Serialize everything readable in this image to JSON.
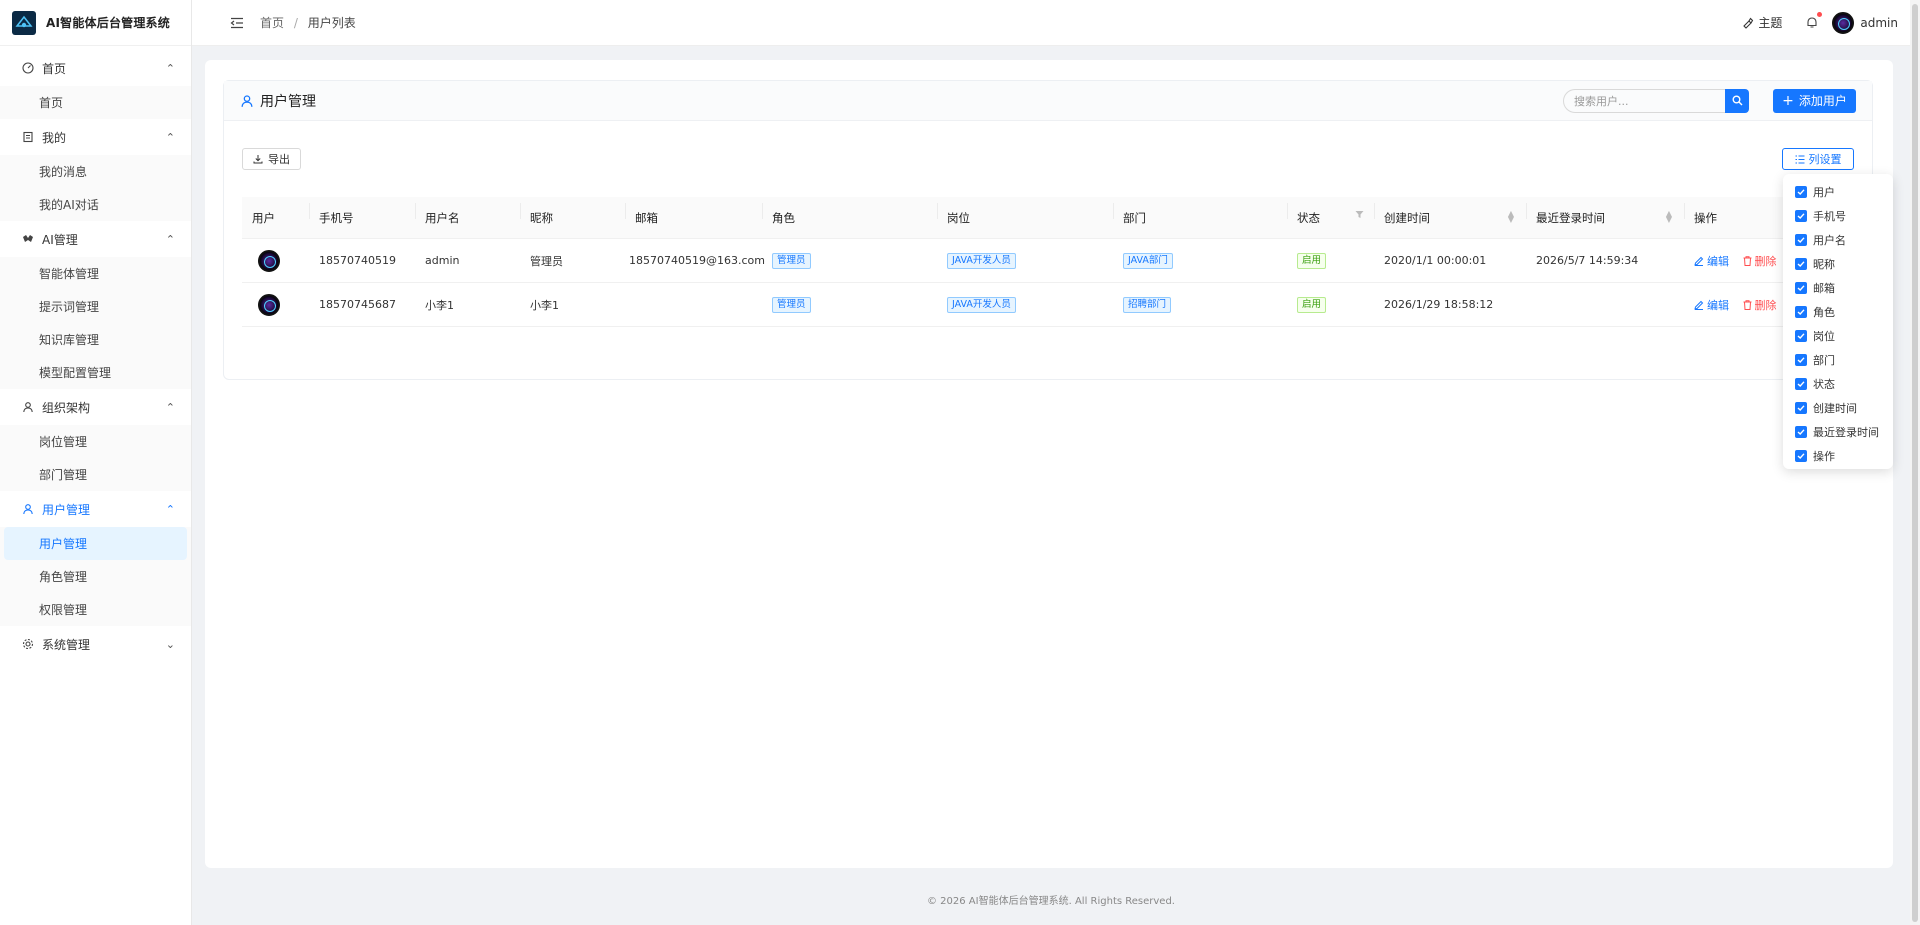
{
  "app": {
    "title": "AI智能体后台管理系统"
  },
  "sidebar": {
    "groups": [
      {
        "label": "首页",
        "icon": "dashboard-icon",
        "items": [
          "首页"
        ]
      },
      {
        "label": "我的",
        "icon": "profile-icon",
        "items": [
          "我的消息",
          "我的AI对话"
        ]
      },
      {
        "label": "AI管理",
        "icon": "ai-icon",
        "items": [
          "智能体管理",
          "提示词管理",
          "知识库管理",
          "模型配置管理"
        ]
      },
      {
        "label": "组织架构",
        "icon": "user-icon",
        "items": [
          "岗位管理",
          "部门管理"
        ]
      },
      {
        "label": "用户管理",
        "icon": "user-icon",
        "items": [
          "用户管理",
          "角色管理",
          "权限管理"
        ],
        "active": true
      },
      {
        "label": "系统管理",
        "icon": "gear-icon",
        "items": []
      }
    ]
  },
  "header": {
    "breadcrumb": {
      "home": "首页",
      "sep": "/",
      "current": "用户列表"
    },
    "theme": "主题",
    "user": "admin"
  },
  "panel": {
    "title": "用户管理",
    "search_placeholder": "搜索用户...",
    "add_label": "添加用户",
    "export_label": "导出",
    "columns_label": "列设置"
  },
  "table": {
    "headers": [
      "用户",
      "手机号",
      "用户名",
      "昵称",
      "邮箱",
      "角色",
      "岗位",
      "部门",
      "状态",
      "创建时间",
      "最近登录时间",
      "操作"
    ],
    "rows": [
      {
        "phone": "18570740519",
        "username": "admin",
        "nickname": "管理员",
        "email": "18570740519@163.com",
        "role": "管理员",
        "post": "JAVA开发人员",
        "dept": "JAVA部门",
        "status": "启用",
        "created": "2020/1/1 00:00:01",
        "last_login": "2026/5/7 14:59:34"
      },
      {
        "phone": "18570745687",
        "username": "小李1",
        "nickname": "小李1",
        "email": "",
        "role": "管理员",
        "post": "JAVA开发人员",
        "dept": "招聘部门",
        "status": "启用",
        "created": "2026/1/29 18:58:12",
        "last_login": ""
      }
    ],
    "actions": {
      "edit": "编辑",
      "delete": "删除"
    }
  },
  "column_settings": [
    "用户",
    "手机号",
    "用户名",
    "昵称",
    "邮箱",
    "角色",
    "岗位",
    "部门",
    "状态",
    "创建时间",
    "最近登录时间",
    "操作"
  ],
  "footer": "© 2026 AI智能体后台管理系统. All Rights Reserved.",
  "colors": {
    "primary": "#1677ff",
    "danger": "#ff4d4f",
    "success": "#389e0d"
  }
}
